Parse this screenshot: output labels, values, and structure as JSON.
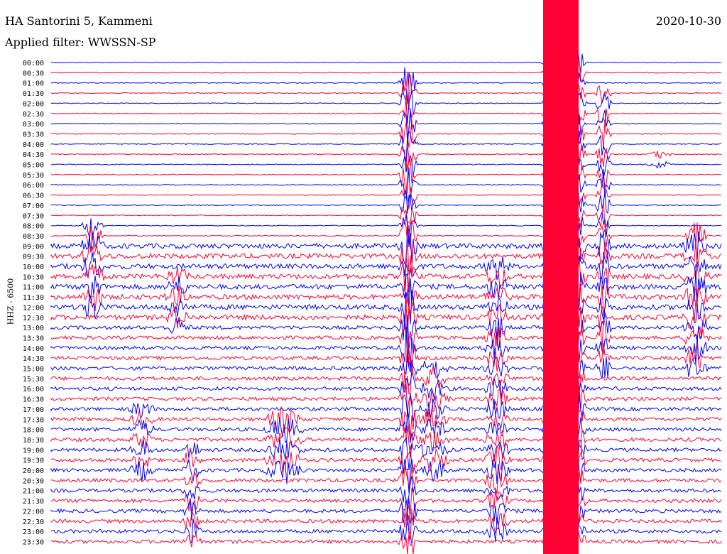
{
  "header": {
    "station": "HA Santorini 5, Kammeni",
    "filter": "Applied filter: WWSSN-SP",
    "date": "2020-10-30"
  },
  "chart_data": {
    "type": "line",
    "title": "HA Santorini 5, Kammeni",
    "subtitle": "Applied filter: WWSSN-SP",
    "date": "2020-10-30",
    "ylabel": "HHZ - 6500",
    "grid": false,
    "row_labels": [
      "00:00",
      "00:30",
      "01:00",
      "01:30",
      "02:00",
      "02:30",
      "03:00",
      "03:30",
      "04:00",
      "04:30",
      "05:00",
      "05:30",
      "06:00",
      "06:30",
      "07:00",
      "07:30",
      "08:00",
      "08:30",
      "09:00",
      "09:30",
      "10:00",
      "10:30",
      "11:00",
      "11:30",
      "12:00",
      "12:30",
      "13:00",
      "13:30",
      "14:00",
      "14:30",
      "15:00",
      "15:30",
      "16:00",
      "16:30",
      "17:00",
      "17:30",
      "18:00",
      "18:30",
      "19:00",
      "19:30",
      "20:00",
      "20:30",
      "21:00",
      "21:30",
      "22:00",
      "22:30",
      "23:00",
      "23:30"
    ],
    "series_colors": [
      "#0000ff",
      "#ff0033"
    ],
    "note_colors": "rows alternate blue (on the hour) and red (half hour)"
  }
}
